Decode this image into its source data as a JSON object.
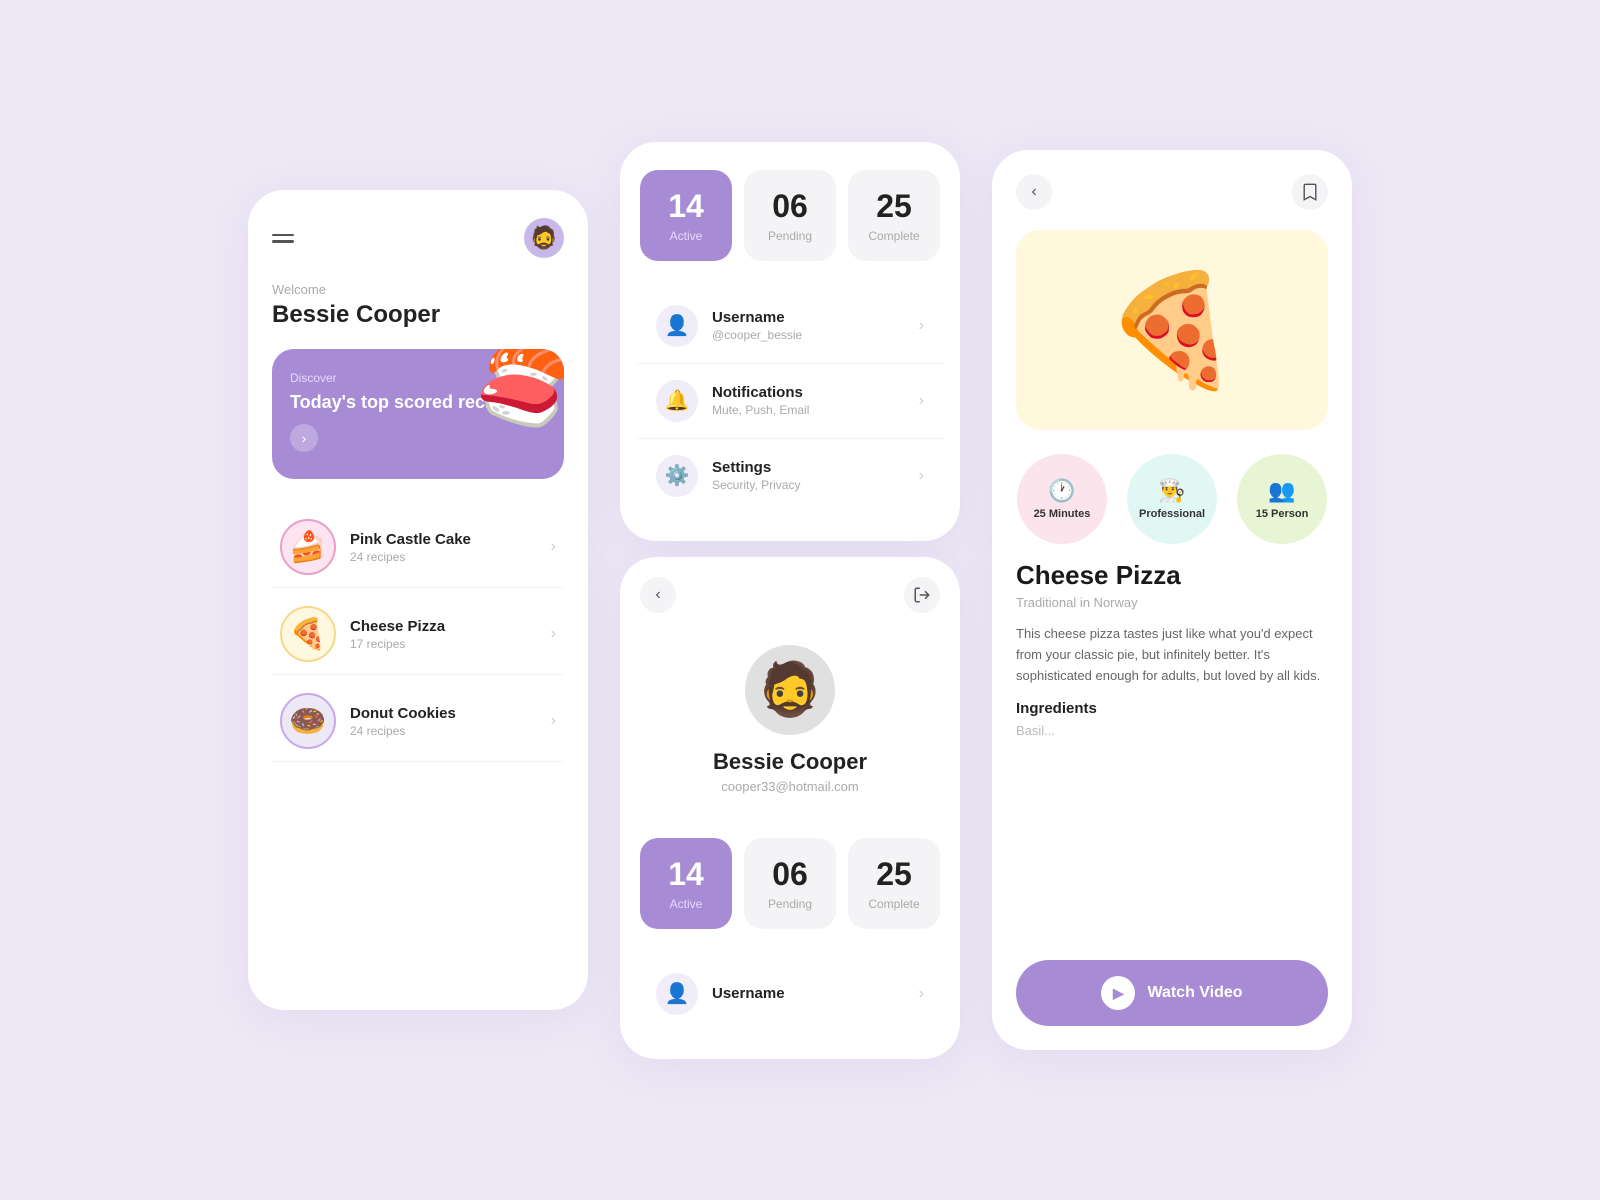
{
  "background": "#ede8f5",
  "card1": {
    "welcome": "Welcome",
    "username": "Bessie Cooper",
    "banner": {
      "discover": "Discover",
      "title": "Today's top scored recipe!",
      "arrow": "›",
      "emoji": "🍣"
    },
    "recipes": [
      {
        "name": "Pink Castle Cake",
        "count": "24 recipes",
        "emoji": "🍰",
        "iconClass": "icon-cake"
      },
      {
        "name": "Cheese Pizza",
        "count": "17 recipes",
        "emoji": "🍕",
        "iconClass": "icon-pizza"
      },
      {
        "name": "Donut Cookies",
        "count": "24 recipes",
        "emoji": "🍩",
        "iconClass": "icon-donut"
      }
    ]
  },
  "card2": {
    "stats": [
      {
        "num": "14",
        "label": "Active",
        "type": "active"
      },
      {
        "num": "06",
        "label": "Pending",
        "type": "neutral"
      },
      {
        "num": "25",
        "label": "Complete",
        "type": "neutral"
      }
    ],
    "menu": [
      {
        "icon": "👤",
        "title": "Username",
        "sub": "@cooper_bessie"
      },
      {
        "icon": "🔔",
        "title": "Notifications",
        "sub": "Mute, Push, Email"
      },
      {
        "icon": "⚙️",
        "title": "Settings",
        "sub": "Security, Privacy"
      }
    ],
    "profile": {
      "name": "Bessie Cooper",
      "email": "cooper33@hotmail.com",
      "emoji": "🧔"
    },
    "stats2": [
      {
        "num": "14",
        "label": "Active",
        "type": "active"
      },
      {
        "num": "06",
        "label": "Pending",
        "type": "neutral"
      },
      {
        "num": "25",
        "label": "Complete",
        "type": "neutral"
      }
    ],
    "menu2": [
      {
        "icon": "👤",
        "title": "Username",
        "sub": ""
      }
    ]
  },
  "card3": {
    "backIcon": "‹",
    "bookmarkIcon": "🔖",
    "foodEmoji": "🍕",
    "badges": [
      {
        "icon": "🕐",
        "label": "25 Minutes",
        "class": "badge-pink"
      },
      {
        "icon": "👨‍🍳",
        "label": "Professional",
        "class": "badge-teal"
      },
      {
        "icon": "👥",
        "label": "15 Person",
        "class": "badge-green"
      }
    ],
    "title": "Cheese Pizza",
    "origin": "Traditional in Norway",
    "description": "This cheese pizza tastes just like what you'd expect from your classic pie, but infinitely better. It's sophisticated enough for adults, but loved by all kids.",
    "ingredientsLabel": "Ingredients",
    "ingredientsFade": "Basil...",
    "watchBtn": "Watch Video"
  }
}
